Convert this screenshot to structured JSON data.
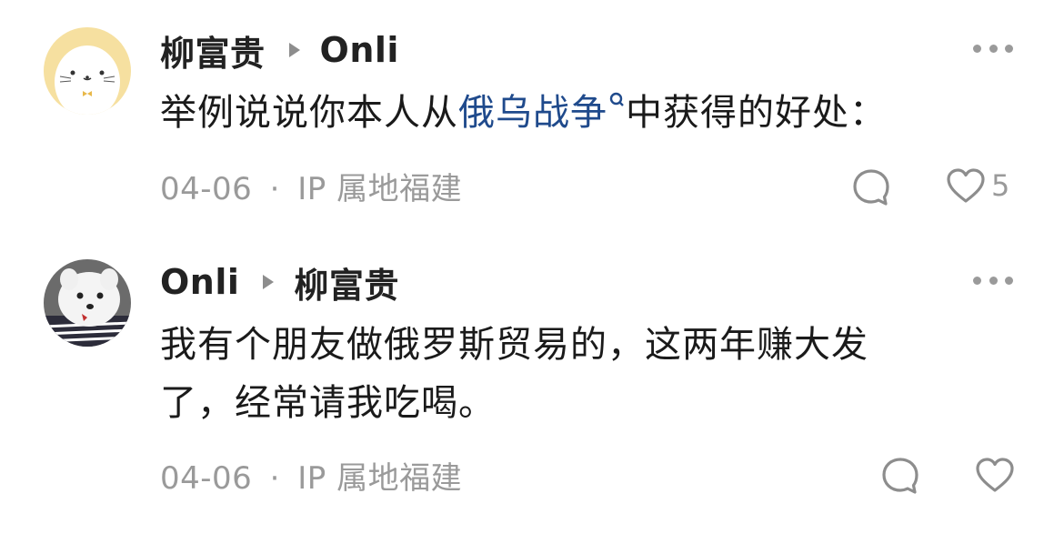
{
  "comments": [
    {
      "author": "柳富贵",
      "reply_to": "Onli",
      "text_before": "举例说说你本人从",
      "link_text": "俄乌战争",
      "text_after": "中获得的好处：",
      "date": "04-06",
      "separator": "·",
      "location": "IP 属地福建",
      "like_count": "5",
      "avatar_icon": "seal-cartoon-avatar"
    },
    {
      "author": "Onli",
      "reply_to": "柳富贵",
      "text_line1": "我有个朋友做俄罗斯贸易的，这两年赚大发",
      "text_line2": "了，经常请我吃喝。",
      "date": "04-06",
      "separator": "·",
      "location": "IP 属地福建",
      "like_count": "",
      "avatar_icon": "white-dog-avatar"
    }
  ],
  "colors": {
    "link": "#1f4a8c",
    "meta": "#9a9a9a",
    "name": "#222222"
  }
}
